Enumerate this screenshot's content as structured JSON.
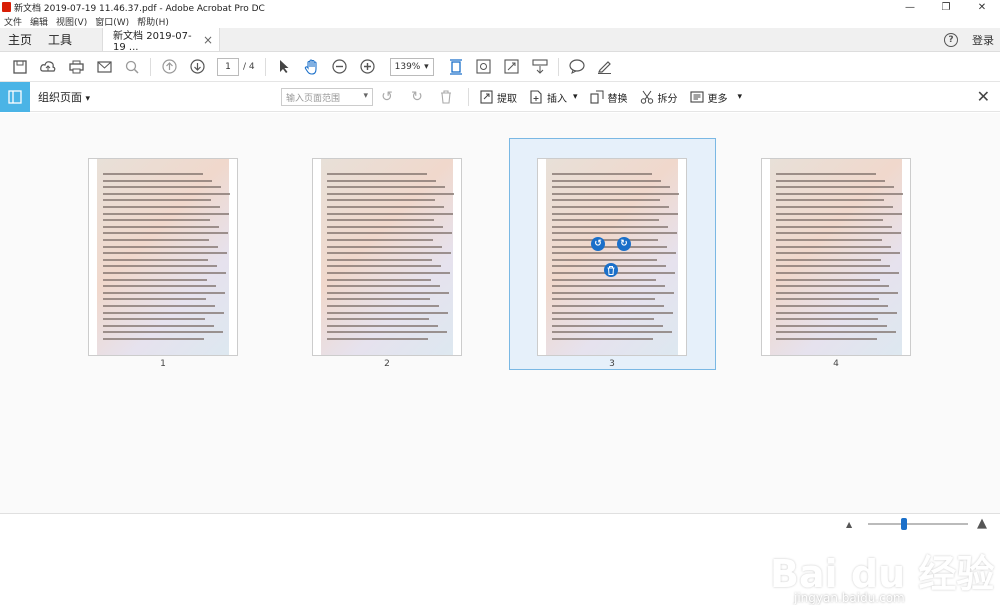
{
  "window": {
    "title": "新文档 2019-07-19 11.46.37.pdf - Adobe Acrobat Pro DC",
    "controls": [
      "—",
      "❐",
      "✕"
    ]
  },
  "menu": [
    "文件",
    "编辑",
    "视图(V)",
    "窗口(W)",
    "帮助(H)"
  ],
  "tabs": {
    "home": "主页",
    "tools": "工具",
    "doc": "新文档 2019-07-19 ...",
    "close": "×",
    "help_icon": "?",
    "login": "登录"
  },
  "toolbar": {
    "page_current": "1",
    "page_total": "/ 4",
    "zoom": "139%",
    "zoom_caret": "▾",
    "icons": [
      "save-icon",
      "upload-icon",
      "print-icon",
      "mail-icon",
      "search-icon",
      "prev-page-icon",
      "next-page-icon",
      "select-arrow-icon",
      "hand-icon",
      "zoom-out-icon",
      "zoom-in-icon",
      "fit-page-icon",
      "rotate-view-icon",
      "full-screen-icon",
      "scroll-mode-icon",
      "comment-icon",
      "sign-icon"
    ]
  },
  "organize": {
    "title": "组织页面",
    "title_caret": "▾",
    "range_placeholder": "输入页面范围",
    "range_caret": "▾",
    "tools": {
      "extract": "提取",
      "insert": "插入",
      "replace": "替换",
      "split": "拆分",
      "more": "更多"
    },
    "tool_caret": "▾",
    "close": "✕"
  },
  "pages": [
    {
      "label": "1"
    },
    {
      "label": "2"
    },
    {
      "label": "3",
      "selected": true
    },
    {
      "label": "4"
    }
  ],
  "page_hover_buttons": {
    "rotate_left": "↺",
    "rotate_right": "↻",
    "delete": "🗑"
  },
  "watermark": {
    "brand": "Bai du 经验",
    "url": "jingyan.baidu.com"
  },
  "colors": {
    "accent": "#4bb4e6",
    "selection": "#e6f0fa",
    "selection_border": "#7ab8e4",
    "button_blue": "#1a6fc9"
  }
}
